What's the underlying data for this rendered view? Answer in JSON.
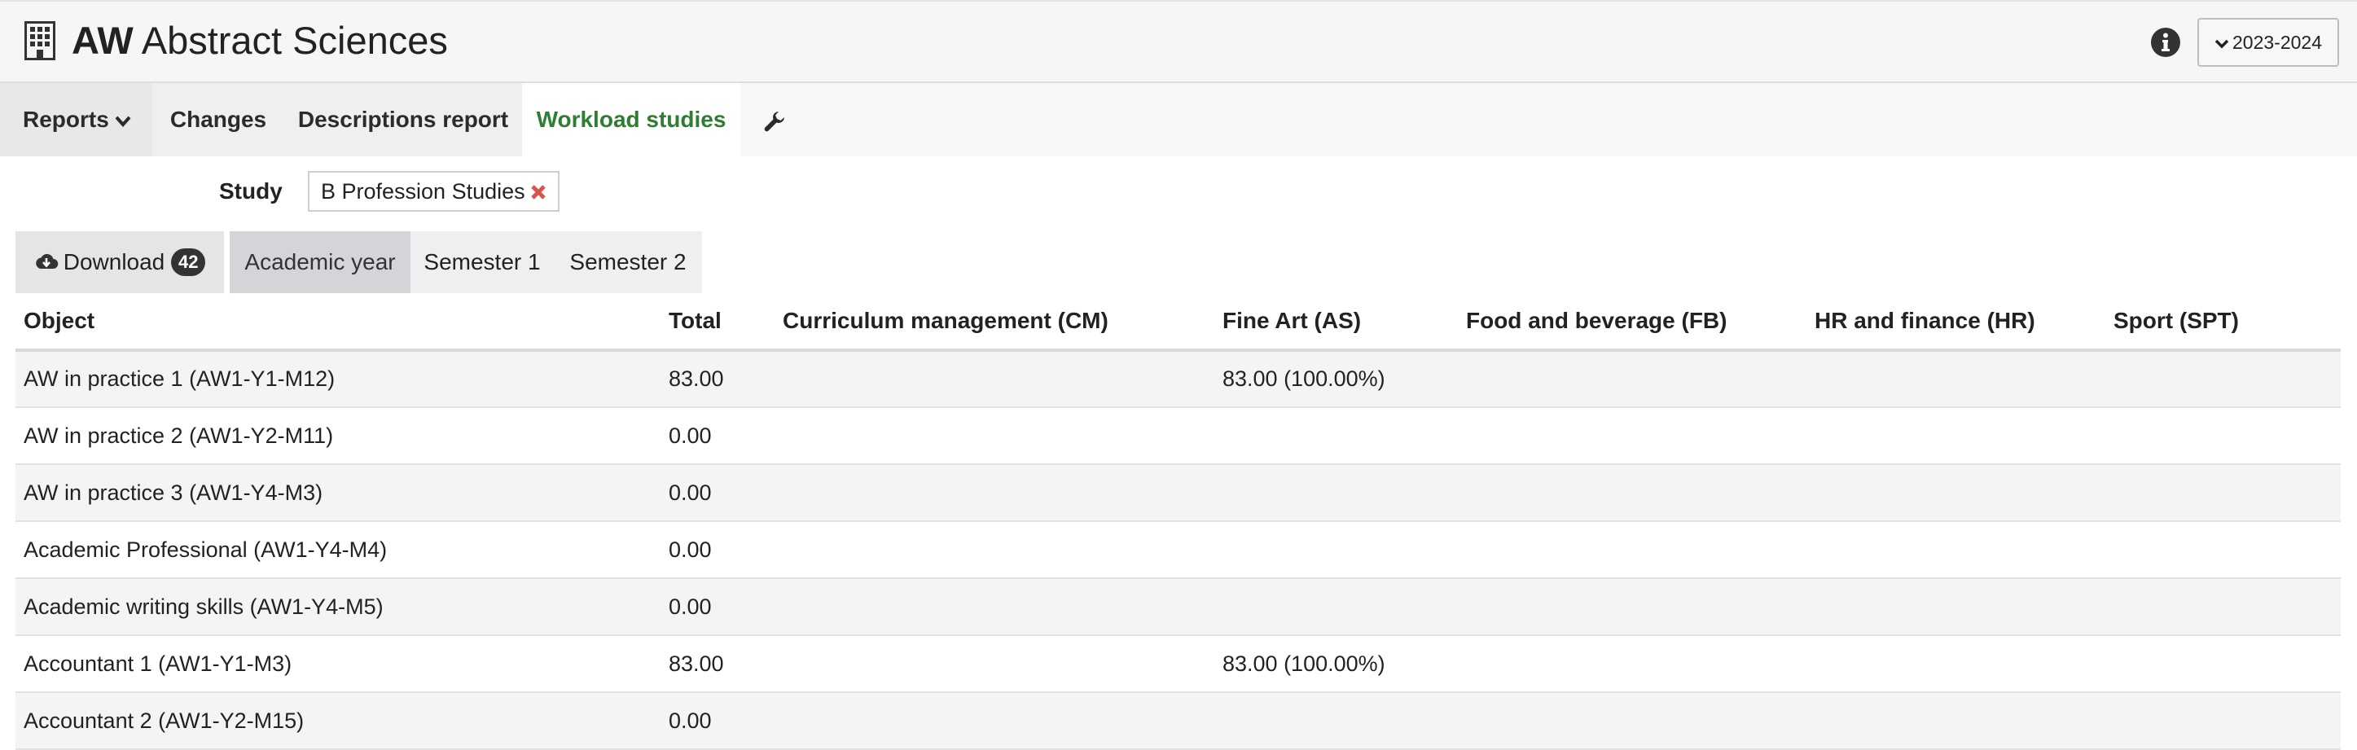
{
  "header": {
    "abbr": "AW",
    "name": "Abstract Sciences",
    "year_selector": "2023-2024"
  },
  "nav": {
    "reports": "Reports",
    "changes": "Changes",
    "descriptions": "Descriptions report",
    "workload": "Workload studies"
  },
  "filter": {
    "study_label": "Study",
    "study_value": "B Profession Studies"
  },
  "period_tabs": {
    "download": "Download",
    "download_count": "42",
    "academic_year": "Academic year",
    "semester1": "Semester 1",
    "semester2": "Semester 2"
  },
  "table": {
    "headers": [
      "Object",
      "Total",
      "Curriculum management (CM)",
      "Fine Art (AS)",
      "Food and beverage (FB)",
      "HR and finance (HR)",
      "Sport (SPT)"
    ],
    "rows": [
      [
        "AW in practice 1 (AW1-Y1-M12)",
        "83.00",
        "",
        "83.00 (100.00%)",
        "",
        "",
        ""
      ],
      [
        "AW in practice 2 (AW1-Y2-M11)",
        "0.00",
        "",
        "",
        "",
        "",
        ""
      ],
      [
        "AW in practice 3 (AW1-Y4-M3)",
        "0.00",
        "",
        "",
        "",
        "",
        ""
      ],
      [
        "Academic Professional (AW1-Y4-M4)",
        "0.00",
        "",
        "",
        "",
        "",
        ""
      ],
      [
        "Academic writing skills (AW1-Y4-M5)",
        "0.00",
        "",
        "",
        "",
        "",
        ""
      ],
      [
        "Accountant 1 (AW1-Y1-M3)",
        "83.00",
        "",
        "83.00 (100.00%)",
        "",
        "",
        ""
      ],
      [
        "Accountant 2 (AW1-Y2-M15)",
        "0.00",
        "",
        "",
        "",
        "",
        ""
      ]
    ]
  },
  "colors": {
    "active_tab": "#2e7d32",
    "remove_icon": "#d9534f"
  },
  "icons": {
    "app": "building-icon",
    "info": "info-icon",
    "settings": "wrench-icon",
    "download": "cloud-download-icon",
    "remove": "remove-icon"
  }
}
